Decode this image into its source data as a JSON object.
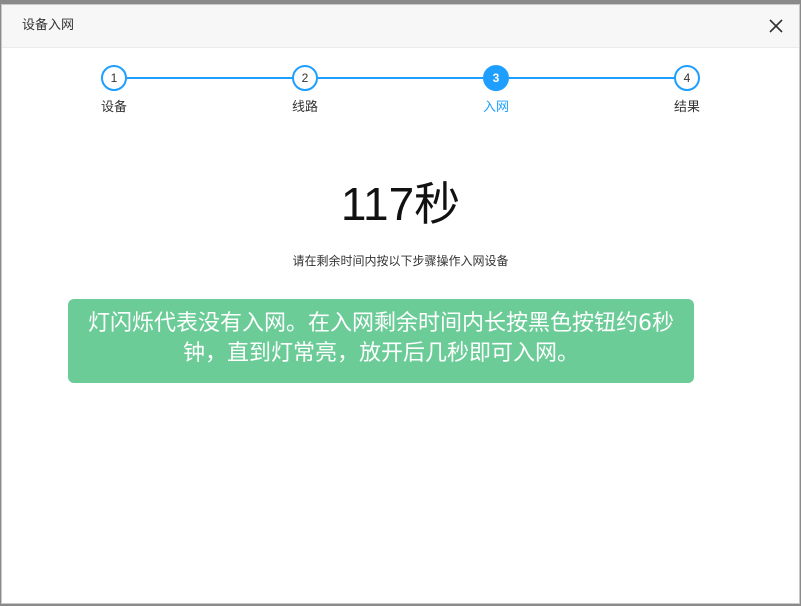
{
  "dialog": {
    "title": "设备入网",
    "close_icon": "close-icon"
  },
  "steps": [
    {
      "number": "1",
      "label": "设备",
      "active": false
    },
    {
      "number": "2",
      "label": "线路",
      "active": false
    },
    {
      "number": "3",
      "label": "入网",
      "active": true
    },
    {
      "number": "4",
      "label": "结果",
      "active": false
    }
  ],
  "countdown": {
    "text": "117秒"
  },
  "instruction": "请在剩余时间内按以下步骤操作入网设备",
  "tip": "灯闪烁代表没有入网。在入网剩余时间内长按黑色按钮约6秒钟，直到灯常亮，放开后几秒即可入网。",
  "colors": {
    "accent": "#1e9fff",
    "tip_background": "#6ccc98"
  }
}
